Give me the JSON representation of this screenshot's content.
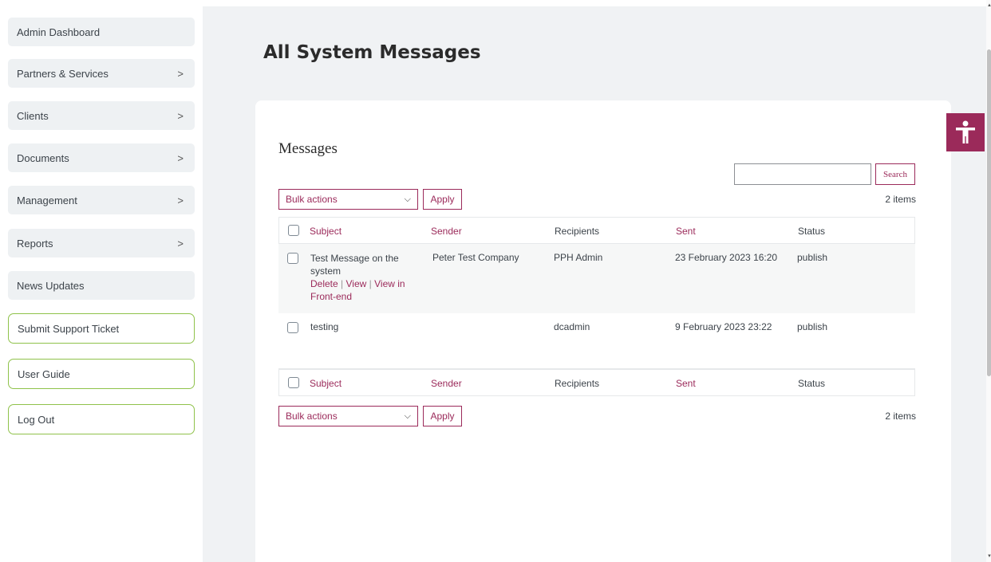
{
  "sidebar": {
    "items": [
      {
        "label": "Admin Dashboard",
        "chevron": false
      },
      {
        "label": "Partners & Services",
        "chevron": true
      },
      {
        "label": "Clients",
        "chevron": true
      },
      {
        "label": "Documents",
        "chevron": true
      },
      {
        "label": "Management",
        "chevron": true
      },
      {
        "label": "Reports",
        "chevron": true
      },
      {
        "label": "News Updates",
        "chevron": false
      },
      {
        "label": "Submit Support Ticket",
        "chevron": false
      },
      {
        "label": "User Guide",
        "chevron": false
      },
      {
        "label": "Log Out",
        "chevron": false
      }
    ],
    "chevron_glyph": ">"
  },
  "main": {
    "page_title": "All System Messages",
    "section_title": "Messages",
    "search": {
      "value": "",
      "button_label": "Search"
    },
    "bulk_actions_label": "Bulk actions",
    "apply_label": "Apply",
    "items_count": "2 items",
    "columns": [
      "Subject",
      "Sender",
      "Recipients",
      "Sent",
      "Status"
    ],
    "rows": [
      {
        "subject_line1": "Test Message on the",
        "subject_line2": "system",
        "action_delete": "Delete",
        "action_sep1": "|",
        "action_view": "View",
        "action_sep2": "|",
        "action_view_front1": "View in",
        "action_view_front2": "Front-end",
        "sender": "Peter Test Company",
        "recipients": "PPH Admin",
        "sent": "23 February 2023 16:20",
        "status": "publish"
      },
      {
        "subject_line1": "testing",
        "sender": "",
        "recipients": "dcadmin",
        "sent": "9 February 2023 23:22",
        "status": "publish"
      }
    ]
  },
  "colors": {
    "accent": "#9b2a5a",
    "green_border": "#8fc24a",
    "bg_gray": "#f0f2f4"
  },
  "icons": {
    "accessibility": "accessibility-person-icon"
  }
}
